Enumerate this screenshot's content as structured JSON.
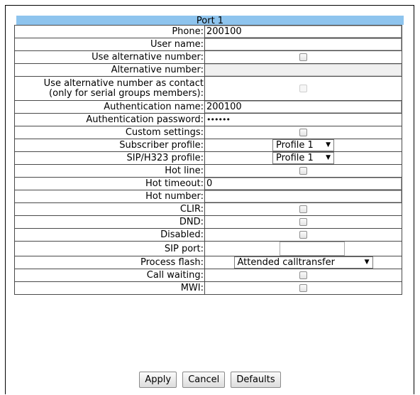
{
  "section_title": "Port 1",
  "fields": {
    "phone": {
      "label": "Phone:",
      "value": "200100"
    },
    "user_name": {
      "label": "User name:",
      "value": ""
    },
    "use_alt_number": {
      "label": "Use alternative number:"
    },
    "alt_number": {
      "label": "Alternative number:",
      "value": ""
    },
    "use_alt_as_contact": {
      "label_line1": "Use alternative number as contact",
      "label_line2": "(only for serial groups members):"
    },
    "auth_name": {
      "label": "Authentication name:",
      "value": "200100"
    },
    "auth_password": {
      "label": "Authentication password:",
      "value": "••••••"
    },
    "custom_settings": {
      "label": "Custom settings:"
    },
    "subscriber_profile": {
      "label": "Subscriber profile:",
      "selected": "Profile 1",
      "arrow": "▼"
    },
    "sip_h323_profile": {
      "label": "SIP/H323 profile:",
      "selected": "Profile 1",
      "arrow": "▼"
    },
    "hot_line": {
      "label": "Hot line:"
    },
    "hot_timeout": {
      "label": "Hot timeout:",
      "value": "0"
    },
    "hot_number": {
      "label": "Hot number:",
      "value": ""
    },
    "clir": {
      "label": "CLIR:"
    },
    "dnd": {
      "label": "DND:"
    },
    "disabled": {
      "label": "Disabled:"
    },
    "sip_port": {
      "label": "SIP port:",
      "value": ""
    },
    "process_flash": {
      "label": "Process flash:",
      "selected": "Attended calltransfer",
      "arrow": "▼"
    },
    "call_waiting": {
      "label": "Call waiting:"
    },
    "mwi": {
      "label": "MWI:"
    }
  },
  "buttons": {
    "apply": "Apply",
    "cancel": "Cancel",
    "defaults": "Defaults"
  },
  "colors": {
    "header_bg": "#8ec4ee"
  }
}
